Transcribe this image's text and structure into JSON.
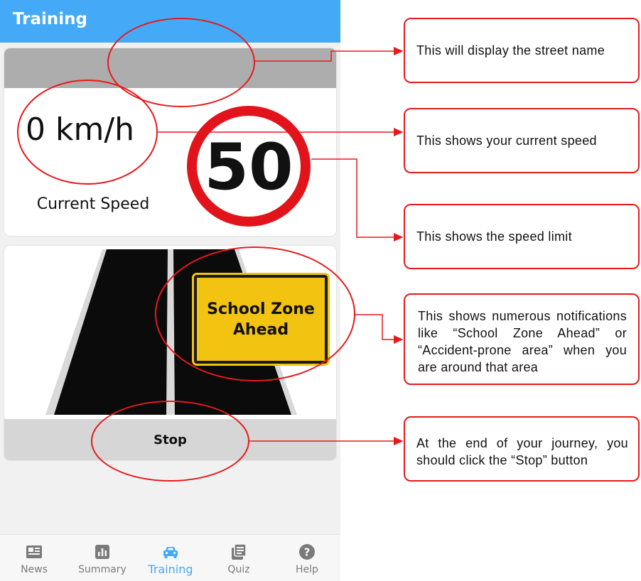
{
  "app": {
    "title": "Training",
    "header_color": "#44aaf7"
  },
  "street": {
    "name": ""
  },
  "speed": {
    "value": "0 km/h",
    "label": "Current Speed"
  },
  "speed_limit": {
    "value": "50",
    "ring_color": "#e1141b"
  },
  "notification": {
    "line1": "School Zone",
    "line2": "Ahead",
    "color": "#f3c312"
  },
  "stop_button": {
    "label": "Stop"
  },
  "bottom_nav": {
    "items": [
      {
        "label": "News",
        "icon": "newspaper-icon"
      },
      {
        "label": "Summary",
        "icon": "bar-chart-icon"
      },
      {
        "label": "Training",
        "icon": "car-icon",
        "active": true
      },
      {
        "label": "Quiz",
        "icon": "clipboard-icon"
      },
      {
        "label": "Help",
        "icon": "help-icon"
      }
    ]
  },
  "annotations": [
    {
      "text": "This will display the street name"
    },
    {
      "text": "This shows your current speed"
    },
    {
      "text": "This shows the speed limit"
    },
    {
      "text": "This shows numerous notifications like “School Zone Ahead” or “Accident-prone area” when you are around that area"
    },
    {
      "text": "At the end of your journey, you should click the “Stop” button"
    }
  ],
  "annotation_color": "#e8191b"
}
